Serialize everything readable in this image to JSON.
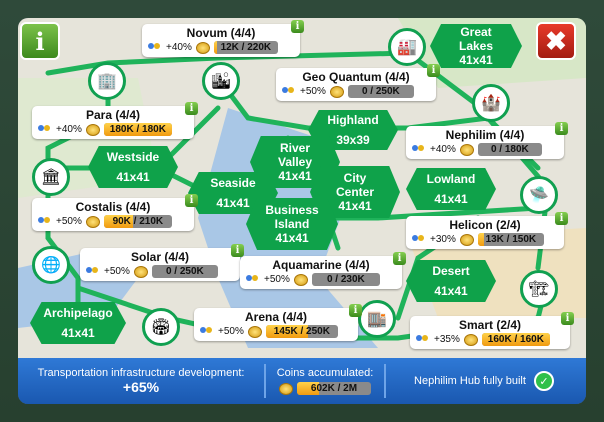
{
  "buttons": {
    "info": "i",
    "close": "✖"
  },
  "districts": [
    {
      "name": "Novum (4/4)",
      "bonus": "+40%",
      "coins": "12K / 220K",
      "progress": 0.055
    },
    {
      "name": "Geo Quantum (4/4)",
      "bonus": "+50%",
      "coins": "0 / 250K",
      "progress": 0
    },
    {
      "name": "Para (4/4)",
      "bonus": "+40%",
      "coins": "180K / 180K",
      "progress": 1
    },
    {
      "name": "Nephilim (4/4)",
      "bonus": "+40%",
      "coins": "0 / 180K",
      "progress": 0
    },
    {
      "name": "Costalis (4/4)",
      "bonus": "+50%",
      "coins": "90K / 210K",
      "progress": 0.43
    },
    {
      "name": "Helicon (2/4)",
      "bonus": "+30%",
      "coins": "13K / 150K",
      "progress": 0.09
    },
    {
      "name": "Solar (4/4)",
      "bonus": "+50%",
      "coins": "0 / 250K",
      "progress": 0
    },
    {
      "name": "Aquamarine (4/4)",
      "bonus": "+50%",
      "coins": "0 / 230K",
      "progress": 0
    },
    {
      "name": "Arena (4/4)",
      "bonus": "+50%",
      "coins": "145K / 250K",
      "progress": 0.58
    },
    {
      "name": "Smart (2/4)",
      "bonus": "+35%",
      "coins": "160K / 160K",
      "progress": 1
    }
  ],
  "zones": [
    {
      "line1": "Great",
      "line2": "Lakes",
      "size": "41x41"
    },
    {
      "line1": "Highland",
      "line2": "",
      "size": "39x39"
    },
    {
      "line1": "River",
      "line2": "Valley",
      "size": "41x41"
    },
    {
      "line1": "City",
      "line2": "Center",
      "size": "41x41"
    },
    {
      "line1": "Westside",
      "line2": "",
      "size": "41x41"
    },
    {
      "line1": "Seaside",
      "line2": "",
      "size": "41x41"
    },
    {
      "line1": "Business",
      "line2": "Island",
      "size": "41x41"
    },
    {
      "line1": "Lowland",
      "line2": "",
      "size": "41x41"
    },
    {
      "line1": "Desert",
      "line2": "",
      "size": "41x41"
    },
    {
      "line1": "Archipelago",
      "line2": "",
      "size": "41x41"
    }
  ],
  "footer": {
    "transport_label": "Transportation infrastructure development:",
    "transport_value": "+65%",
    "coins_label": "Coins accumulated:",
    "coins_value": "602K / 2M",
    "coins_progress": 0.3,
    "hub_status": "Nephilim Hub fully built"
  },
  "colors": {
    "road": "#1fb35a",
    "zone": "#0fa24a",
    "water": "#a9c7e6",
    "footer": "#1e63bf"
  }
}
